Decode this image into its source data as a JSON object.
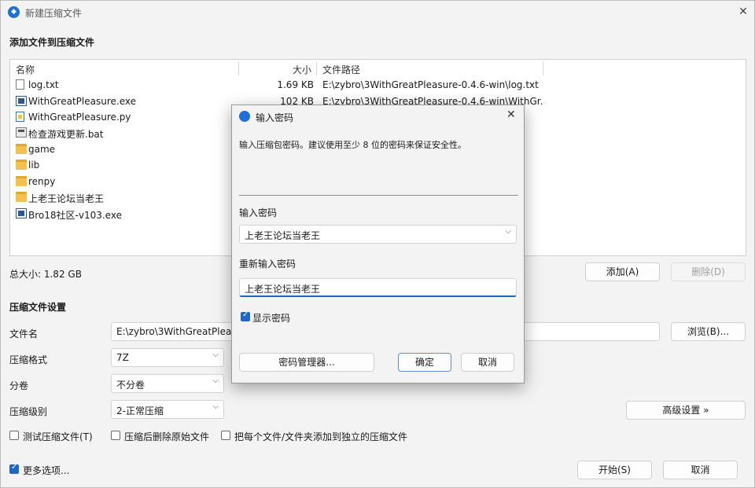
{
  "window": {
    "title": "新建压缩文件",
    "close_glyph": "✕"
  },
  "add_section": {
    "title": "添加文件到压缩文件"
  },
  "file_list": {
    "columns": [
      "名称",
      "大小",
      "文件路径"
    ],
    "rows": [
      {
        "name": "log.txt",
        "size": "1.69 KB",
        "path": "E:\\zybro\\3WithGreatPleasure-0.4.6-win\\log.txt",
        "icon": "text-file-icon"
      },
      {
        "name": "WithGreatPleasure.exe",
        "size": "102 KB",
        "path": "E:\\zybro\\3WithGreatPleasure-0.4.6-win\\WithGr...",
        "icon": "exe-file-icon"
      },
      {
        "name": "WithGreatPleasure.py",
        "size": "",
        "path": "",
        "icon": "python-file-icon"
      },
      {
        "name": "检查游戏更新.bat",
        "size": "",
        "path": "",
        "icon": "bat-file-icon"
      },
      {
        "name": "game",
        "size": "",
        "path": "",
        "icon": "folder-icon"
      },
      {
        "name": "lib",
        "size": "",
        "path": "",
        "icon": "folder-icon"
      },
      {
        "name": "renpy",
        "size": "",
        "path": "",
        "icon": "folder-icon"
      },
      {
        "name": "上老王论坛当老王",
        "size": "",
        "path": "",
        "icon": "folder-icon"
      },
      {
        "name": "Bro18社区-v103.exe",
        "size": "",
        "path": "",
        "icon": "exe-file-icon"
      }
    ]
  },
  "total_size": "总大小: 1.82 GB",
  "buttons": {
    "add": "添加(A)",
    "remove": "删除(D)",
    "browse": "浏览(B)...",
    "advanced": "高级设置 »",
    "start": "开始(S)",
    "cancel": "取消"
  },
  "settings": {
    "title": "压缩文件设置",
    "filename_label": "文件名",
    "filename_value": "E:\\zybro\\3WithGreatPleasu",
    "format_label": "压缩格式",
    "format_value": "7Z",
    "split_label": "分卷",
    "split_value": "不分卷",
    "level_label": "压缩级别",
    "level_value": "2-正常压缩",
    "chevron": "⌵"
  },
  "options": {
    "test": "测试压缩文件(T)",
    "delete_src": "压缩后删除原始文件",
    "separate": "把每个文件/文件夹添加到独立的压缩文件",
    "more": "更多选项..."
  },
  "dialog": {
    "title": "输入密码",
    "close_glyph": "✕",
    "info": "输入压缩包密码。建议使用至少 8 位的密码来保证安全性。",
    "password_label": "输入密码",
    "password_value": "上老王论坛当老王",
    "confirm_label": "重新输入密码",
    "confirm_value": "上老王论坛当老王",
    "show_password": "显示密码",
    "manager": "密码管理器...",
    "ok": "确定",
    "cancel": "取消"
  }
}
